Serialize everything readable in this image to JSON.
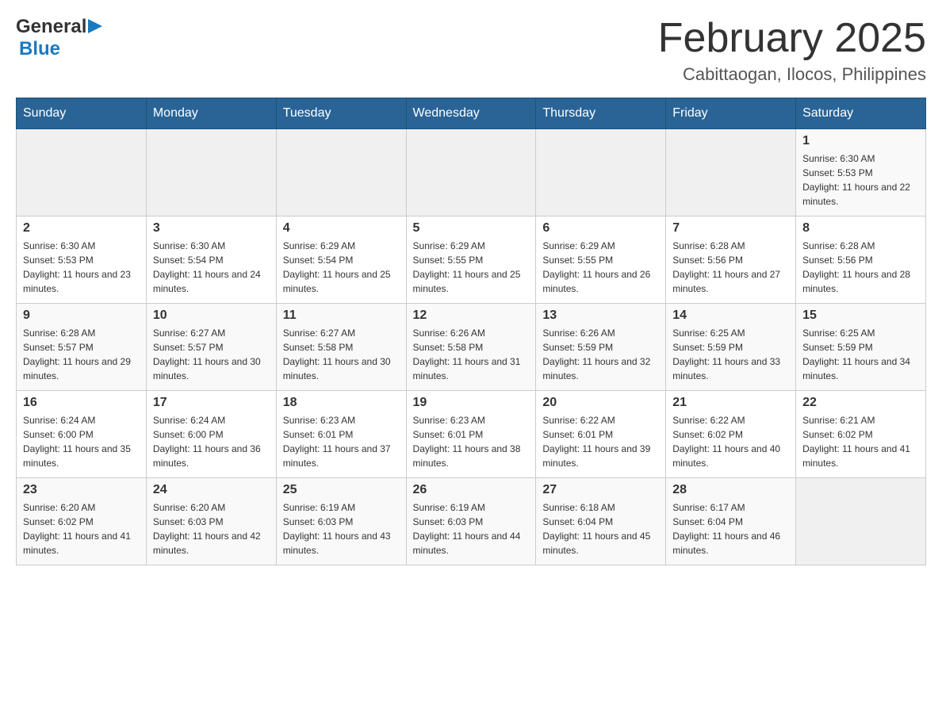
{
  "header": {
    "logo": {
      "general": "General",
      "blue": "Blue"
    },
    "title": "February 2025",
    "location": "Cabittaogan, Ilocos, Philippines"
  },
  "calendar": {
    "days_of_week": [
      "Sunday",
      "Monday",
      "Tuesday",
      "Wednesday",
      "Thursday",
      "Friday",
      "Saturday"
    ],
    "weeks": [
      [
        {
          "day": "",
          "sunrise": "",
          "sunset": "",
          "daylight": ""
        },
        {
          "day": "",
          "sunrise": "",
          "sunset": "",
          "daylight": ""
        },
        {
          "day": "",
          "sunrise": "",
          "sunset": "",
          "daylight": ""
        },
        {
          "day": "",
          "sunrise": "",
          "sunset": "",
          "daylight": ""
        },
        {
          "day": "",
          "sunrise": "",
          "sunset": "",
          "daylight": ""
        },
        {
          "day": "",
          "sunrise": "",
          "sunset": "",
          "daylight": ""
        },
        {
          "day": "1",
          "sunrise": "Sunrise: 6:30 AM",
          "sunset": "Sunset: 5:53 PM",
          "daylight": "Daylight: 11 hours and 22 minutes."
        }
      ],
      [
        {
          "day": "2",
          "sunrise": "Sunrise: 6:30 AM",
          "sunset": "Sunset: 5:53 PM",
          "daylight": "Daylight: 11 hours and 23 minutes."
        },
        {
          "day": "3",
          "sunrise": "Sunrise: 6:30 AM",
          "sunset": "Sunset: 5:54 PM",
          "daylight": "Daylight: 11 hours and 24 minutes."
        },
        {
          "day": "4",
          "sunrise": "Sunrise: 6:29 AM",
          "sunset": "Sunset: 5:54 PM",
          "daylight": "Daylight: 11 hours and 25 minutes."
        },
        {
          "day": "5",
          "sunrise": "Sunrise: 6:29 AM",
          "sunset": "Sunset: 5:55 PM",
          "daylight": "Daylight: 11 hours and 25 minutes."
        },
        {
          "day": "6",
          "sunrise": "Sunrise: 6:29 AM",
          "sunset": "Sunset: 5:55 PM",
          "daylight": "Daylight: 11 hours and 26 minutes."
        },
        {
          "day": "7",
          "sunrise": "Sunrise: 6:28 AM",
          "sunset": "Sunset: 5:56 PM",
          "daylight": "Daylight: 11 hours and 27 minutes."
        },
        {
          "day": "8",
          "sunrise": "Sunrise: 6:28 AM",
          "sunset": "Sunset: 5:56 PM",
          "daylight": "Daylight: 11 hours and 28 minutes."
        }
      ],
      [
        {
          "day": "9",
          "sunrise": "Sunrise: 6:28 AM",
          "sunset": "Sunset: 5:57 PM",
          "daylight": "Daylight: 11 hours and 29 minutes."
        },
        {
          "day": "10",
          "sunrise": "Sunrise: 6:27 AM",
          "sunset": "Sunset: 5:57 PM",
          "daylight": "Daylight: 11 hours and 30 minutes."
        },
        {
          "day": "11",
          "sunrise": "Sunrise: 6:27 AM",
          "sunset": "Sunset: 5:58 PM",
          "daylight": "Daylight: 11 hours and 30 minutes."
        },
        {
          "day": "12",
          "sunrise": "Sunrise: 6:26 AM",
          "sunset": "Sunset: 5:58 PM",
          "daylight": "Daylight: 11 hours and 31 minutes."
        },
        {
          "day": "13",
          "sunrise": "Sunrise: 6:26 AM",
          "sunset": "Sunset: 5:59 PM",
          "daylight": "Daylight: 11 hours and 32 minutes."
        },
        {
          "day": "14",
          "sunrise": "Sunrise: 6:25 AM",
          "sunset": "Sunset: 5:59 PM",
          "daylight": "Daylight: 11 hours and 33 minutes."
        },
        {
          "day": "15",
          "sunrise": "Sunrise: 6:25 AM",
          "sunset": "Sunset: 5:59 PM",
          "daylight": "Daylight: 11 hours and 34 minutes."
        }
      ],
      [
        {
          "day": "16",
          "sunrise": "Sunrise: 6:24 AM",
          "sunset": "Sunset: 6:00 PM",
          "daylight": "Daylight: 11 hours and 35 minutes."
        },
        {
          "day": "17",
          "sunrise": "Sunrise: 6:24 AM",
          "sunset": "Sunset: 6:00 PM",
          "daylight": "Daylight: 11 hours and 36 minutes."
        },
        {
          "day": "18",
          "sunrise": "Sunrise: 6:23 AM",
          "sunset": "Sunset: 6:01 PM",
          "daylight": "Daylight: 11 hours and 37 minutes."
        },
        {
          "day": "19",
          "sunrise": "Sunrise: 6:23 AM",
          "sunset": "Sunset: 6:01 PM",
          "daylight": "Daylight: 11 hours and 38 minutes."
        },
        {
          "day": "20",
          "sunrise": "Sunrise: 6:22 AM",
          "sunset": "Sunset: 6:01 PM",
          "daylight": "Daylight: 11 hours and 39 minutes."
        },
        {
          "day": "21",
          "sunrise": "Sunrise: 6:22 AM",
          "sunset": "Sunset: 6:02 PM",
          "daylight": "Daylight: 11 hours and 40 minutes."
        },
        {
          "day": "22",
          "sunrise": "Sunrise: 6:21 AM",
          "sunset": "Sunset: 6:02 PM",
          "daylight": "Daylight: 11 hours and 41 minutes."
        }
      ],
      [
        {
          "day": "23",
          "sunrise": "Sunrise: 6:20 AM",
          "sunset": "Sunset: 6:02 PM",
          "daylight": "Daylight: 11 hours and 41 minutes."
        },
        {
          "day": "24",
          "sunrise": "Sunrise: 6:20 AM",
          "sunset": "Sunset: 6:03 PM",
          "daylight": "Daylight: 11 hours and 42 minutes."
        },
        {
          "day": "25",
          "sunrise": "Sunrise: 6:19 AM",
          "sunset": "Sunset: 6:03 PM",
          "daylight": "Daylight: 11 hours and 43 minutes."
        },
        {
          "day": "26",
          "sunrise": "Sunrise: 6:19 AM",
          "sunset": "Sunset: 6:03 PM",
          "daylight": "Daylight: 11 hours and 44 minutes."
        },
        {
          "day": "27",
          "sunrise": "Sunrise: 6:18 AM",
          "sunset": "Sunset: 6:04 PM",
          "daylight": "Daylight: 11 hours and 45 minutes."
        },
        {
          "day": "28",
          "sunrise": "Sunrise: 6:17 AM",
          "sunset": "Sunset: 6:04 PM",
          "daylight": "Daylight: 11 hours and 46 minutes."
        },
        {
          "day": "",
          "sunrise": "",
          "sunset": "",
          "daylight": ""
        }
      ]
    ]
  }
}
